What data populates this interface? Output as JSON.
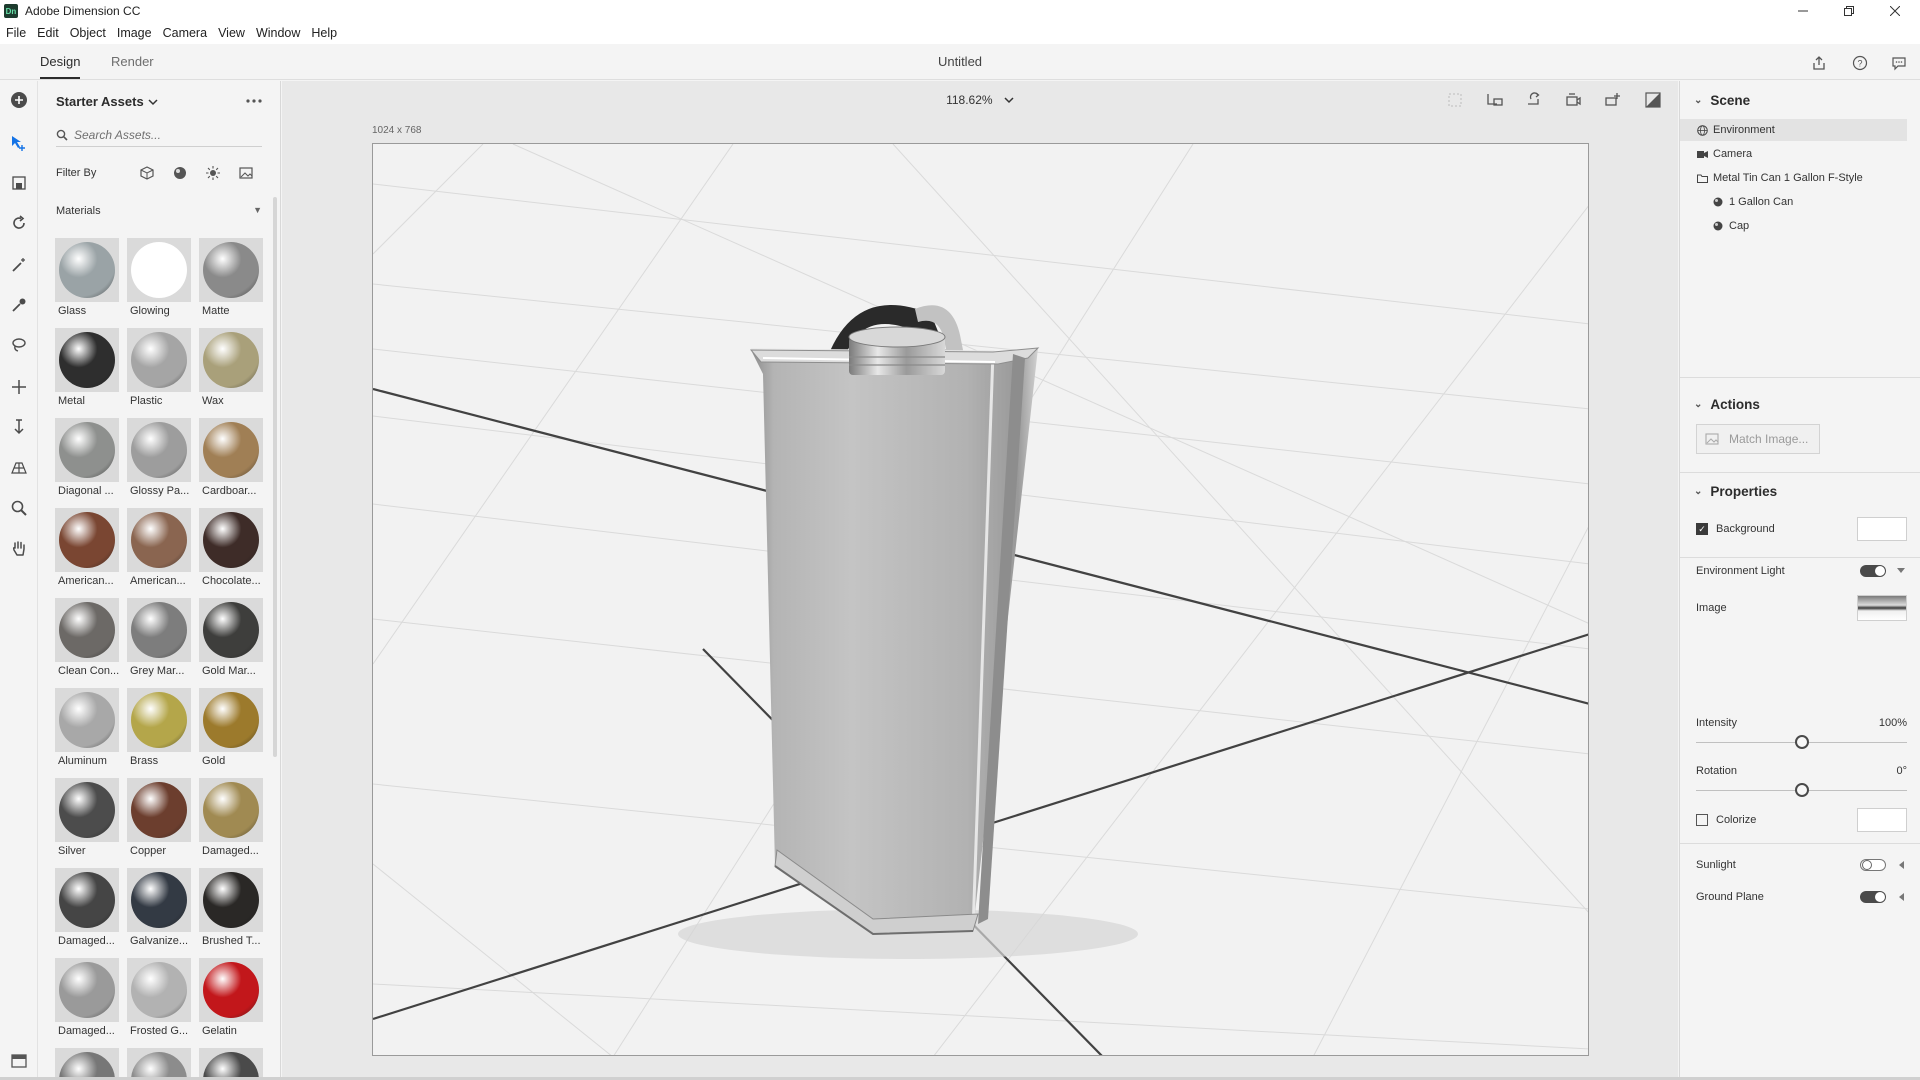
{
  "window": {
    "app_logo": "Dn",
    "title": "Adobe Dimension CC"
  },
  "menu": [
    "File",
    "Edit",
    "Object",
    "Image",
    "Camera",
    "View",
    "Window",
    "Help"
  ],
  "modes": {
    "design": "Design",
    "render": "Render"
  },
  "document": {
    "title": "Untitled",
    "zoom": "118.62%",
    "canvas_size": "1024 x 768"
  },
  "assets": {
    "title": "Starter Assets",
    "search_placeholder": "Search Assets...",
    "filter_label": "Filter By",
    "section": "Materials",
    "materials": [
      {
        "name": "Glass",
        "color": "#9aa3a6"
      },
      {
        "name": "Glowing",
        "color": "#ffffff"
      },
      {
        "name": "Matte",
        "color": "#8a8a8a"
      },
      {
        "name": "Metal",
        "color": "#2e2e2e"
      },
      {
        "name": "Plastic",
        "color": "#a5a5a5"
      },
      {
        "name": "Wax",
        "color": "#a9a07a"
      },
      {
        "name": "Diagonal ...",
        "color": "#8e908e"
      },
      {
        "name": "Glossy Pa...",
        "color": "#9d9d9d"
      },
      {
        "name": "Cardboar...",
        "color": "#a07f55"
      },
      {
        "name": "American...",
        "color": "#7a4632"
      },
      {
        "name": "American...",
        "color": "#8a6550"
      },
      {
        "name": "Chocolate...",
        "color": "#3e2c28"
      },
      {
        "name": "Clean Con...",
        "color": "#6c6966"
      },
      {
        "name": "Grey Mar...",
        "color": "#7d7d7d"
      },
      {
        "name": "Gold Mar...",
        "color": "#3e3e3c"
      },
      {
        "name": "Aluminum",
        "color": "#a8a8a8"
      },
      {
        "name": "Brass",
        "color": "#b4a64a"
      },
      {
        "name": "Gold",
        "color": "#9c7a2c"
      },
      {
        "name": "Silver",
        "color": "#4c4c4c"
      },
      {
        "name": "Copper",
        "color": "#6c3e2e"
      },
      {
        "name": "Damaged...",
        "color": "#a08a52"
      },
      {
        "name": "Damaged...",
        "color": "#454545"
      },
      {
        "name": "Galvanize...",
        "color": "#333a44"
      },
      {
        "name": "Brushed T...",
        "color": "#2a2826"
      },
      {
        "name": "Damaged...",
        "color": "#9a9a9a"
      },
      {
        "name": "Frosted G...",
        "color": "#b2b2b2"
      },
      {
        "name": "Gelatin",
        "color": "#c2171b"
      },
      {
        "name": "",
        "color": "#777777"
      },
      {
        "name": "",
        "color": "#8c8c8c"
      },
      {
        "name": "",
        "color": "#4a4a4a"
      }
    ]
  },
  "scene": {
    "title": "Scene",
    "items": [
      "Environment",
      "Camera",
      "Metal Tin Can 1 Gallon F-Style",
      "1 Gallon Can",
      "Cap"
    ]
  },
  "actions": {
    "title": "Actions",
    "match_image": "Match Image..."
  },
  "properties": {
    "title": "Properties",
    "background": "Background",
    "environment_light": "Environment Light",
    "image": "Image",
    "intensity": "Intensity",
    "intensity_value": "100%",
    "intensity_fraction": 0.5,
    "rotation": "Rotation",
    "rotation_value": "0°",
    "rotation_fraction": 0.5,
    "colorize": "Colorize",
    "sunlight": "Sunlight",
    "ground_plane": "Ground Plane"
  }
}
